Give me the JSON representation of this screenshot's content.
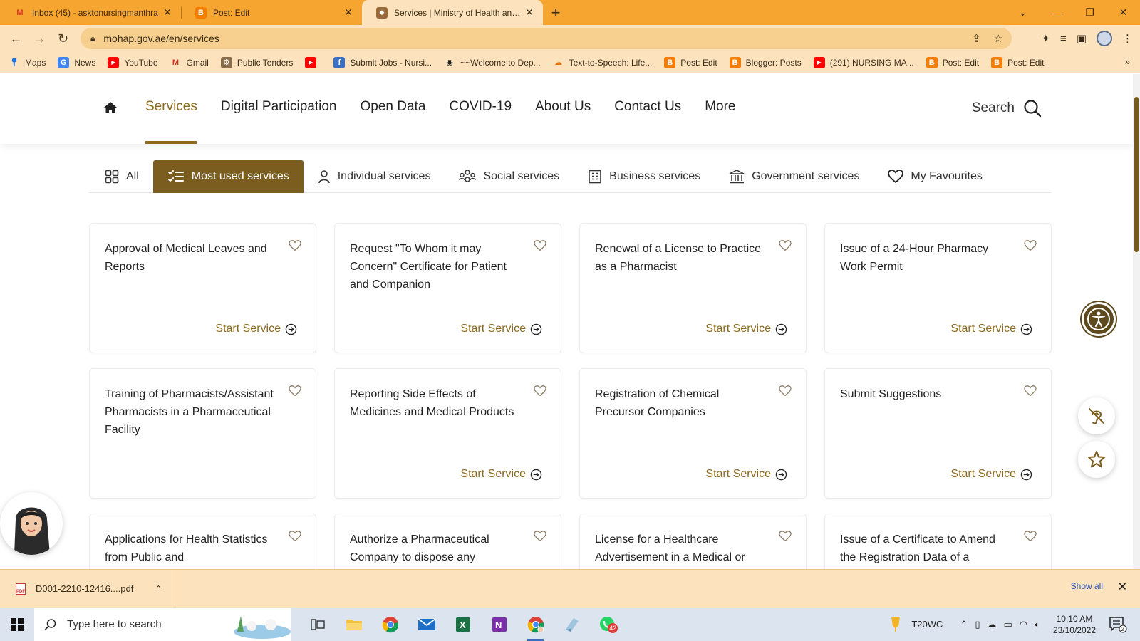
{
  "browser": {
    "tabs": [
      {
        "icon": "gmail-icon",
        "title": "Inbox (45) - asktonursingmanthra",
        "active": false
      },
      {
        "icon": "blogger-icon",
        "title": "Post: Edit",
        "active": false
      },
      {
        "icon": "mohap-icon",
        "title": "Services | Ministry of Health and Prevention",
        "active": true
      }
    ],
    "url": "mohap.gov.ae/en/services",
    "bookmarks": [
      {
        "icon": "maps-icon",
        "label": "Maps"
      },
      {
        "icon": "news-icon",
        "label": "News"
      },
      {
        "icon": "youtube-icon",
        "label": "YouTube"
      },
      {
        "icon": "gmail-icon",
        "label": "Gmail"
      },
      {
        "icon": "tenders-icon",
        "label": "Public Tenders"
      },
      {
        "icon": "youtube-icon",
        "label": ""
      },
      {
        "icon": "submit-icon",
        "label": "Submit Jobs - Nursi..."
      },
      {
        "icon": "globe-icon",
        "label": "~~Welcome to Dep..."
      },
      {
        "icon": "cloud-icon",
        "label": "Text-to-Speech: Life..."
      },
      {
        "icon": "blogger-icon",
        "label": "Post: Edit"
      },
      {
        "icon": "blogger-icon",
        "label": "Blogger: Posts"
      },
      {
        "icon": "youtube-icon",
        "label": "(291) NURSING MA..."
      },
      {
        "icon": "blogger-icon",
        "label": "Post: Edit"
      },
      {
        "icon": "blogger-icon",
        "label": "Post: Edit"
      }
    ]
  },
  "site": {
    "nav": {
      "items": [
        "Services",
        "Digital Participation",
        "Open Data",
        "COVID-19",
        "About Us",
        "Contact Us",
        "More"
      ],
      "active": "Services",
      "search_label": "Search"
    },
    "categories": [
      {
        "icon": "grid-icon",
        "label": "All"
      },
      {
        "icon": "checklist-icon",
        "label": "Most used services",
        "active": true
      },
      {
        "icon": "person-icon",
        "label": "Individual services"
      },
      {
        "icon": "people-icon",
        "label": "Social services"
      },
      {
        "icon": "building-icon",
        "label": "Business services"
      },
      {
        "icon": "bank-icon",
        "label": "Government services"
      },
      {
        "icon": "heart-icon",
        "label": "My Favourites"
      }
    ],
    "start_label": "Start Service",
    "services": [
      "Approval of Medical Leaves and Reports",
      "Request \"To Whom it may Concern\" Certificate for Patient and Companion",
      "Renewal of a License to Practice as a Pharmacist",
      "Issue of a 24-Hour Pharmacy Work Permit",
      "Training of Pharmacists/Assistant Pharmacists in a Pharmaceutical Facility",
      "Reporting Side Effects of Medicines and Medical Products",
      "Registration of Chemical Precursor Companies",
      "Submit Suggestions",
      "Applications for Health Statistics from Public and",
      "Authorize a Pharmaceutical Company to dispose any",
      "License for a Healthcare Advertisement in a Medical or",
      "Issue of a Certificate to Amend the Registration Data of a"
    ]
  },
  "downloads": {
    "file": "D001-2210-12416....pdf",
    "show_all": "Show all"
  },
  "taskbar": {
    "search_placeholder": "Type here to search",
    "weather": "T20WC",
    "time": "10:10 AM",
    "date": "23/10/2022",
    "whatsapp_badge": "42",
    "notification_badge": "2"
  },
  "colors": {
    "brand": "#8c6a1d",
    "brand_dark": "#7c5d20",
    "chrome": "#f7a531",
    "chrome_light": "#fde3bd"
  }
}
